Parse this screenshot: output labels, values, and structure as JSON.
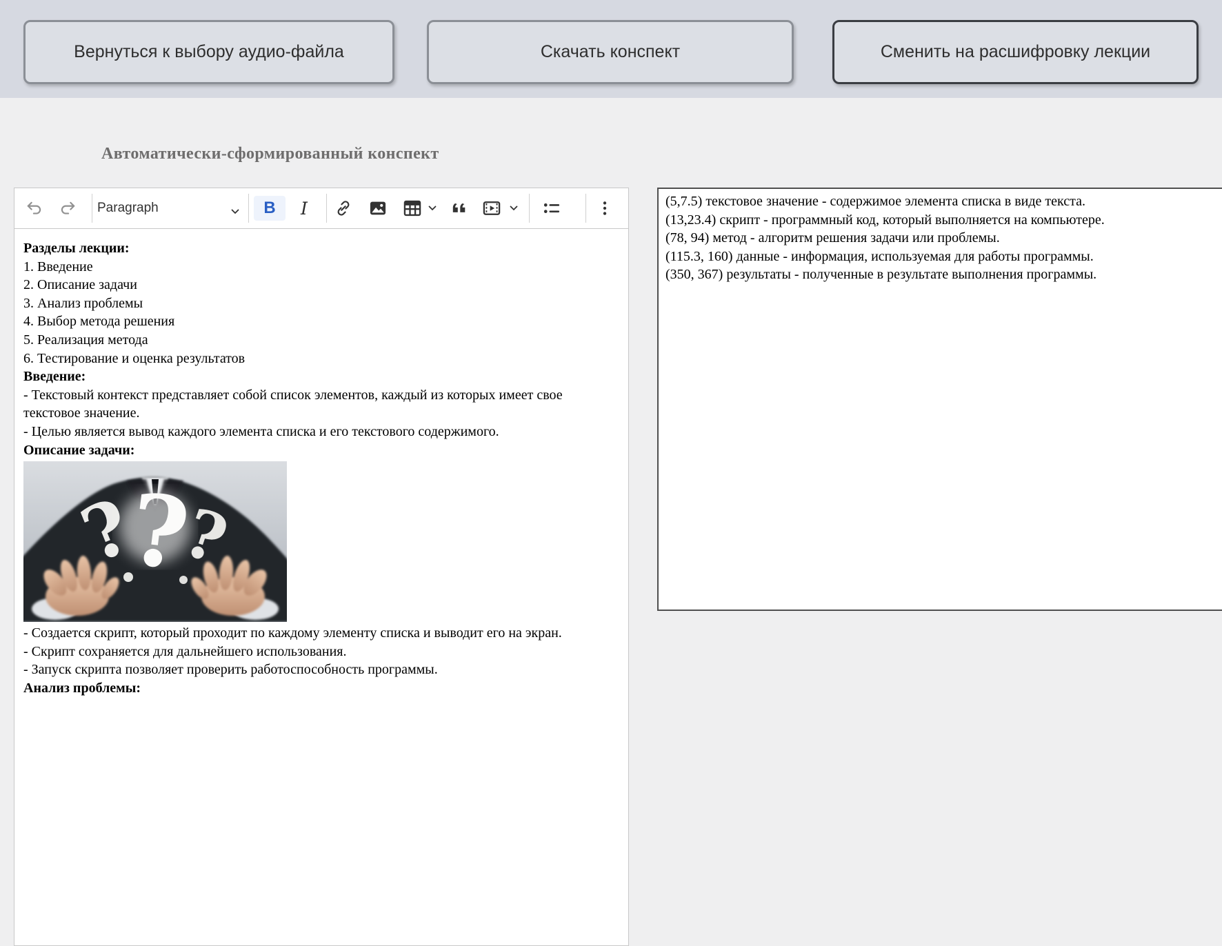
{
  "topbar": {
    "back_button": "Вернуться к выбору аудио-файла",
    "download_button": "Скачать конспект",
    "switch_button": "Сменить на расшифровку лекции"
  },
  "page": {
    "heading": "Автоматически-сформированный конспект"
  },
  "editor": {
    "toolbar": {
      "paragraph_dropdown": "Paragraph",
      "bold_label": "B",
      "italic_label": "I"
    },
    "content": [
      {
        "style": "bold",
        "text": "Разделы лекции:"
      },
      {
        "style": "normal",
        "text": "1. Введение"
      },
      {
        "style": "normal",
        "text": "2. Описание задачи"
      },
      {
        "style": "normal",
        "text": "3. Анализ проблемы"
      },
      {
        "style": "normal",
        "text": "4. Выбор метода решения"
      },
      {
        "style": "normal",
        "text": "5. Реализация метода"
      },
      {
        "style": "normal",
        "text": "6. Тестирование и оценка результатов"
      },
      {
        "style": "bold",
        "text": "Введение:"
      },
      {
        "style": "normal",
        "text": "- Текстовый контекст представляет собой список элементов, каждый из которых имеет свое текстовое значение."
      },
      {
        "style": "normal",
        "text": "- Целью является вывод каждого элемента списка и его текстового содержимого."
      },
      {
        "style": "bold",
        "text": "Описание задачи:"
      }
    ],
    "content_after_image": [
      {
        "style": "normal",
        "text": "- Создается скрипт, который проходит по каждому элементу списка и выводит его на экран."
      },
      {
        "style": "normal",
        "text": "- Скрипт сохраняется для дальнейшего использования."
      },
      {
        "style": "normal",
        "text": "- Запуск скрипта позволяет проверить работоспособность программы."
      },
      {
        "style": "bold",
        "text": "Анализ проблемы:"
      }
    ],
    "photo": {
      "marks": [
        "?",
        "?",
        "?"
      ]
    }
  },
  "transcript": {
    "lines": [
      "(5,7.5) текстовое значение - содержимое элемента списка в виде текста.",
      "(13,23.4) скрипт - программный код, который выполняется на компьютере.",
      "(78, 94) метод - алгоритм решения задачи или проблемы.",
      "(115.3, 160) данные - информация, используемая для работы программы.",
      "(350, 367) результаты - полученные в результате выполнения программы."
    ]
  },
  "colors": {
    "topbar_bg": "#d6d9e1",
    "page_bg": "#efeff0",
    "accent_blue": "#2a5fc4",
    "panel_border": "#4f4f4f",
    "editor_border": "#c8c8c8"
  }
}
